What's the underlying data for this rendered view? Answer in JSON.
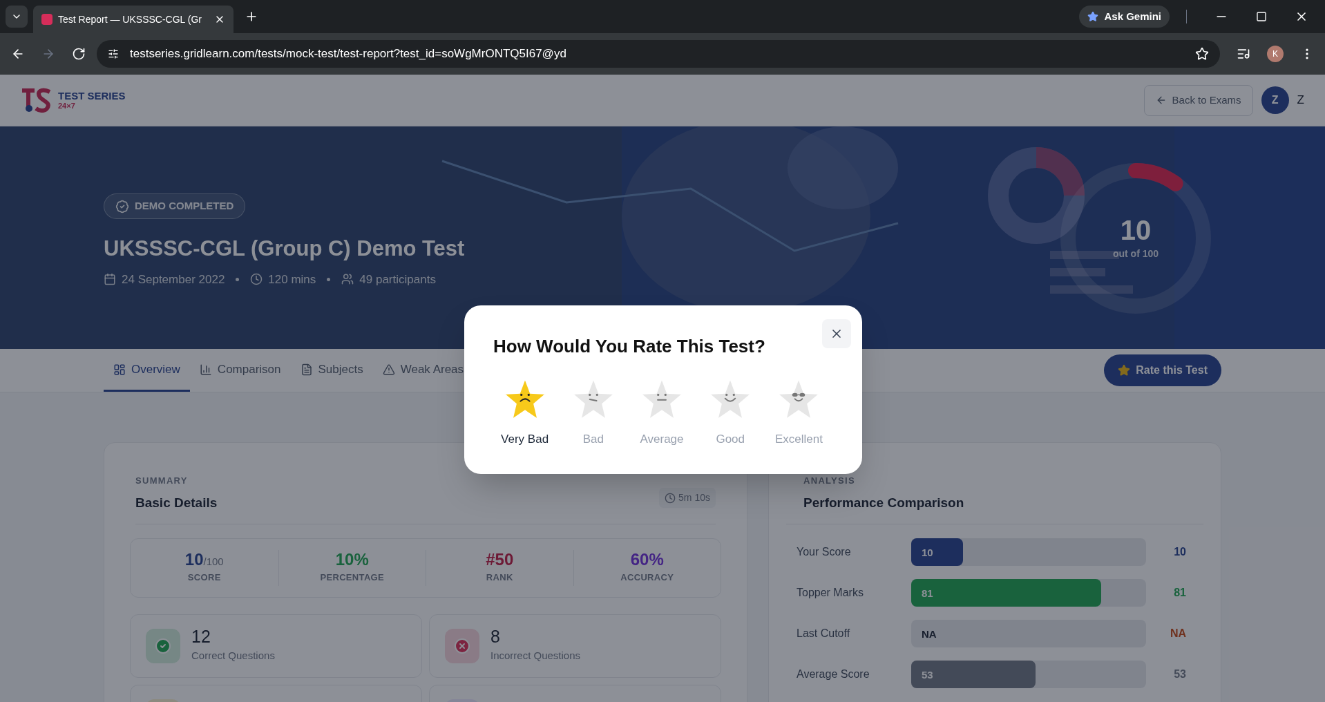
{
  "browser": {
    "tab_title": "Test Report — UKSSSC-CGL (Gr",
    "url": "testseries.gridlearn.com/tests/mock-test/test-report?test_id=soWgMrONTQ5I67@yd",
    "ask_button": "Ask Gemini",
    "profile_initial": "K"
  },
  "header": {
    "logo_title": "TEST SERIES",
    "logo_subtitle": "24×7",
    "back_button": "Back to Exams",
    "avatar_initial": "Z",
    "user_name": "Z"
  },
  "hero": {
    "badge": "DEMO COMPLETED",
    "title": "UKSSSC-CGL (Group C) Demo Test",
    "date": "24 September 2022",
    "duration": "120 mins",
    "participants": "49 participants",
    "score": {
      "value": "10",
      "caption": "out of 100",
      "level": 0.1
    }
  },
  "tabs": [
    {
      "label": "Overview",
      "selected": true
    },
    {
      "label": "Comparison",
      "selected": false
    },
    {
      "label": "Subjects",
      "selected": false
    },
    {
      "label": "Weak Areas",
      "selected": false
    }
  ],
  "rate_button": "Rate this Test",
  "summary": {
    "eyebrow": "SUMMARY",
    "title": "Basic Details",
    "time": "5m 10s",
    "stats": [
      {
        "value": "10",
        "suffix": "/100",
        "label": "SCORE"
      },
      {
        "value": "10%",
        "label": "PERCENTAGE"
      },
      {
        "value": "#50",
        "label": "RANK"
      },
      {
        "value": "60%",
        "label": "ACCURACY"
      }
    ],
    "tiles": [
      {
        "kind": "correct",
        "value": "12",
        "label": "Correct Questions"
      },
      {
        "kind": "incorrect",
        "value": "8",
        "label": "Incorrect Questions"
      },
      {
        "kind": "pending"
      },
      {
        "kind": "time"
      }
    ]
  },
  "analysis": {
    "eyebrow": "ANALYSIS",
    "title": "Performance Comparison",
    "rows": [
      {
        "label": "Your Score",
        "bar_text": "10",
        "level": 0.22,
        "value": "10"
      },
      {
        "label": "Topper Marks",
        "bar_text": "81",
        "level": 0.81,
        "value": "81"
      },
      {
        "label": "Last Cutoff",
        "bar_text": "NA",
        "value": "NA"
      },
      {
        "label": "Average Score",
        "bar_text": "53",
        "level": 0.53,
        "value": "53"
      }
    ]
  },
  "modal": {
    "title": "How Would You Rate This Test?",
    "options": [
      {
        "label": "Very Bad",
        "kind": "sad",
        "selected": true
      },
      {
        "label": "Bad",
        "kind": "skeptic",
        "selected": false
      },
      {
        "label": "Average",
        "kind": "neutral",
        "selected": false
      },
      {
        "label": "Good",
        "kind": "smile",
        "selected": false
      },
      {
        "label": "Excellent",
        "kind": "cool",
        "selected": false
      }
    ]
  }
}
